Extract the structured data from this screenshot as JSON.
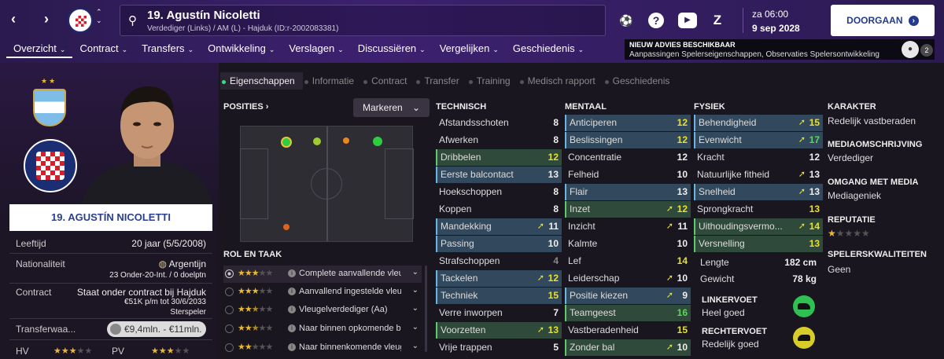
{
  "header": {
    "player_title": "19. Agustín Nicoletti",
    "player_sub": "Verdediger (Links) / AM (L) - Hajduk (ID:r-2002083381)",
    "date_line1": "za 06:00",
    "date_line2": "9 sep 2028",
    "continue_label": "DOORGAAN",
    "continue_icon": "›"
  },
  "menu": [
    {
      "label": "Overzicht"
    },
    {
      "label": "Contract"
    },
    {
      "label": "Transfers"
    },
    {
      "label": "Ontwikkeling"
    },
    {
      "label": "Verslagen"
    },
    {
      "label": "Discussiëren"
    },
    {
      "label": "Vergelijken"
    },
    {
      "label": "Geschiedenis"
    }
  ],
  "advice": {
    "title": "NIEUW ADVIES BESCHIKBAAR",
    "text": "Aanpassingen Spelerseigenschappen, Observaties Spelersontwikkeling",
    "count": "2"
  },
  "profile": {
    "name_banner": "19. AGUSTÍN NICOLETTI",
    "age_label": "Leeftijd",
    "age_value": "20 jaar (5/5/2008)",
    "nat_label": "Nationaliteit",
    "nat_value": "Argentijn",
    "nat_caps": "23 Onder-20-Int. / 0 doelptn",
    "contract_label": "Contract",
    "contract_value1": "Staat onder contract bij Hajduk",
    "contract_value2": "€51K p/m tot 30/6/2033",
    "contract_value3": "Sterspeler",
    "transfer_label": "Transferwaa...",
    "transfer_value": "€9,4mln. - €11mln.",
    "hv_label": "HV",
    "pv_label": "PV",
    "hv_stars": 3,
    "pv_stars": 3
  },
  "tabs": [
    "Eigenschappen",
    "Informatie",
    "Contract",
    "Transfer",
    "Training",
    "Medisch rapport",
    "Geschiedenis"
  ],
  "positions": {
    "heading": "POSITIES",
    "mark_label": "Markeren"
  },
  "roles": {
    "heading": "ROL EN TAAK",
    "items": [
      {
        "label": "Complete aanvallende vleu...",
        "stars": 3
      },
      {
        "label": "Aanvallend ingestelde vleu...",
        "stars": 3
      },
      {
        "label": "Vleugelverdediger (Aa)",
        "stars": 2.5
      },
      {
        "label": "Naar binnen opkomende b...",
        "stars": 2.5
      },
      {
        "label": "Naar binnenkomende vleug...",
        "stars": 2
      }
    ]
  },
  "technisch": {
    "heading": "TECHNISCH",
    "items": [
      {
        "name": "Afstandsschoten",
        "value": "8"
      },
      {
        "name": "Afwerken",
        "value": "8"
      },
      {
        "name": "Dribbelen",
        "value": "12"
      },
      {
        "name": "Eerste balcontact",
        "value": "13"
      },
      {
        "name": "Hoekschoppen",
        "value": "8"
      },
      {
        "name": "Koppen",
        "value": "8"
      },
      {
        "name": "Mandekking",
        "value": "11"
      },
      {
        "name": "Passing",
        "value": "10"
      },
      {
        "name": "Strafschoppen",
        "value": "4"
      },
      {
        "name": "Tackelen",
        "value": "12"
      },
      {
        "name": "Techniek",
        "value": "15"
      },
      {
        "name": "Verre inworpen",
        "value": "7"
      },
      {
        "name": "Voorzetten",
        "value": "13"
      },
      {
        "name": "Vrije trappen",
        "value": "5"
      }
    ]
  },
  "mentaal": {
    "heading": "MENTAAL",
    "items": [
      {
        "name": "Anticiperen",
        "value": "12"
      },
      {
        "name": "Beslissingen",
        "value": "12"
      },
      {
        "name": "Concentratie",
        "value": "12"
      },
      {
        "name": "Felheid",
        "value": "10"
      },
      {
        "name": "Flair",
        "value": "13"
      },
      {
        "name": "Inzet",
        "value": "12"
      },
      {
        "name": "Inzicht",
        "value": "11"
      },
      {
        "name": "Kalmte",
        "value": "10"
      },
      {
        "name": "Lef",
        "value": "14"
      },
      {
        "name": "Leiderschap",
        "value": "10"
      },
      {
        "name": "Positie kiezen",
        "value": "9"
      },
      {
        "name": "Teamgeest",
        "value": "16"
      },
      {
        "name": "Vastberadenheid",
        "value": "15"
      },
      {
        "name": "Zonder bal",
        "value": "10"
      }
    ]
  },
  "fysiek": {
    "heading": "FYSIEK",
    "items": [
      {
        "name": "Behendigheid",
        "value": "15"
      },
      {
        "name": "Evenwicht",
        "value": "17"
      },
      {
        "name": "Kracht",
        "value": "12"
      },
      {
        "name": "Natuurlijke fitheid",
        "value": "13"
      },
      {
        "name": "Snelheid",
        "value": "13"
      },
      {
        "name": "Sprongkracht",
        "value": "13"
      },
      {
        "name": "Uithoudingsvermo...",
        "value": "14"
      },
      {
        "name": "Versnelling",
        "value": "13"
      }
    ],
    "height_label": "Lengte",
    "height_value": "182 cm",
    "weight_label": "Gewicht",
    "weight_value": "78 kg"
  },
  "feet": {
    "left_label": "LINKERVOET",
    "left_value": "Heel goed",
    "right_label": "RECHTERVOET",
    "right_value": "Redelijk goed"
  },
  "right_panel": {
    "karakter_label": "KARAKTER",
    "karakter_value": "Redelijk vastberaden",
    "media_label": "MEDIAOMSCHRIJVING",
    "media_value": "Verdediger",
    "omgang_label": "OMGANG MET MEDIA",
    "omgang_value": "Mediageniek",
    "reputatie_label": "REPUTATIE",
    "reputatie_stars": 1,
    "kwal_label": "SPELERSKWALITEITEN",
    "kwal_value": "Geen"
  },
  "colors": {
    "topbar": "#3d2170",
    "accent_green": "#3ddc84",
    "star": "#e8b933",
    "arrow_up": "#e8e030"
  },
  "icons": [
    "back-arrow-icon",
    "forward-arrow-icon",
    "search-icon",
    "football-icon",
    "help-icon",
    "youtube-icon",
    "z-icon"
  ]
}
